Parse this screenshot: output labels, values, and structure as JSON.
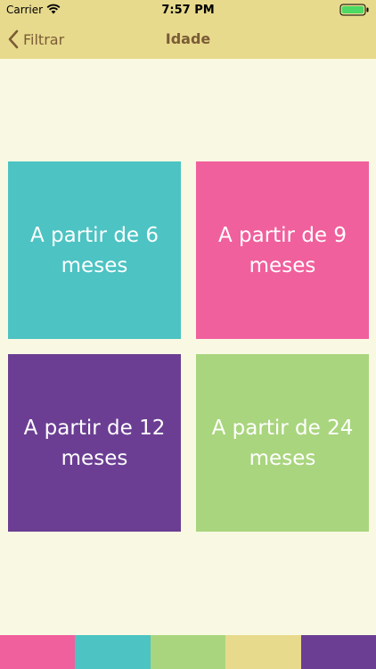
{
  "status_bar": {
    "carrier": "Carrier",
    "time": "7:57 PM",
    "icons": [
      "wifi-icon",
      "battery-icon"
    ]
  },
  "nav": {
    "back_label": "Filtrar",
    "title": "Idade",
    "back_icon": "chevron-left-icon",
    "text_color": "#7b5c35",
    "bar_color": "#e7da8d"
  },
  "tiles": [
    {
      "label": "A partir de 6 meses",
      "color": "#4dc3c3"
    },
    {
      "label": "A partir de 9 meses",
      "color": "#f0609d"
    },
    {
      "label": "A partir de 12 meses",
      "color": "#6b3e93"
    },
    {
      "label": "A partir de 24 meses",
      "color": "#a9d57e"
    }
  ],
  "tab_bar": {
    "segments": [
      "#f0609d",
      "#4dc3c3",
      "#a9d57e",
      "#e7da8d",
      "#6b3e93"
    ]
  },
  "colors": {
    "background": "#f9f9e3"
  }
}
